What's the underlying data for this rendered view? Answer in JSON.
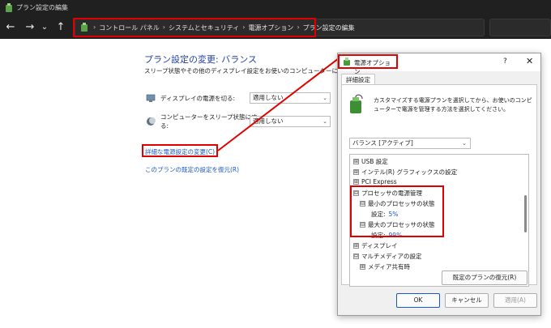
{
  "window": {
    "title": "プラン設定の編集"
  },
  "navigation": {
    "back": "←",
    "forward": "→",
    "history": "⌄",
    "up": "↑",
    "breadcrumbs": [
      "コントロール パネル",
      "システムとセキュリティ",
      "電源オプション",
      "プラン設定の編集"
    ],
    "separator": "›",
    "dropdown": "⌄",
    "refresh": "↻"
  },
  "main": {
    "heading": "プラン設定の変更: バランス",
    "description": "スリープ状態やその他のディスプレイ設定をお使いのコンピューターに適用するま",
    "settings": [
      {
        "label": "ディスプレイの電源を切る:",
        "value": "適用しない"
      },
      {
        "label": "コンピューターをスリープ状態にする:",
        "value": "適用しない"
      }
    ],
    "link_advanced": "詳細な電源設定の変更(C)",
    "link_restore": "このプランの既定の設定を復元(R)"
  },
  "dialog": {
    "title": "電源オプション",
    "help": "?",
    "close": "✕",
    "tab": "詳細設定",
    "info": "カスタマイズする電源プランを選択してから、お使いのコンピューターで電源を管理する方法を選択してください。",
    "plan": "バランス [アクティブ]",
    "tree": [
      {
        "expander": "⊞",
        "label": "USB 設定"
      },
      {
        "expander": "⊞",
        "label": "インテル(R) グラフィックスの設定"
      },
      {
        "expander": "⊞",
        "label": "PCI Express"
      },
      {
        "expander": "⊟",
        "label": "プロセッサの電源管理"
      },
      {
        "expander": "⊟",
        "label": "最小のプロセッサの状態"
      },
      {
        "label": "設定:",
        "value": "5%"
      },
      {
        "expander": "⊟",
        "label": "最大のプロセッサの状態"
      },
      {
        "label": "設定:",
        "value": "99%"
      },
      {
        "expander": "⊞",
        "label": "ディスプレイ"
      },
      {
        "expander": "⊟",
        "label": "マルチメディアの設定"
      },
      {
        "expander": "⊞",
        "label": "メディア共有時"
      }
    ],
    "restore_button": "既定のプランの復元(R)",
    "ok": "OK",
    "cancel": "キャンセル",
    "apply": "適用(A)"
  },
  "colors": {
    "highlight": "#e00000",
    "link": "#1a56c6",
    "heading": "#1f3fa6",
    "chrome": "#202020"
  }
}
